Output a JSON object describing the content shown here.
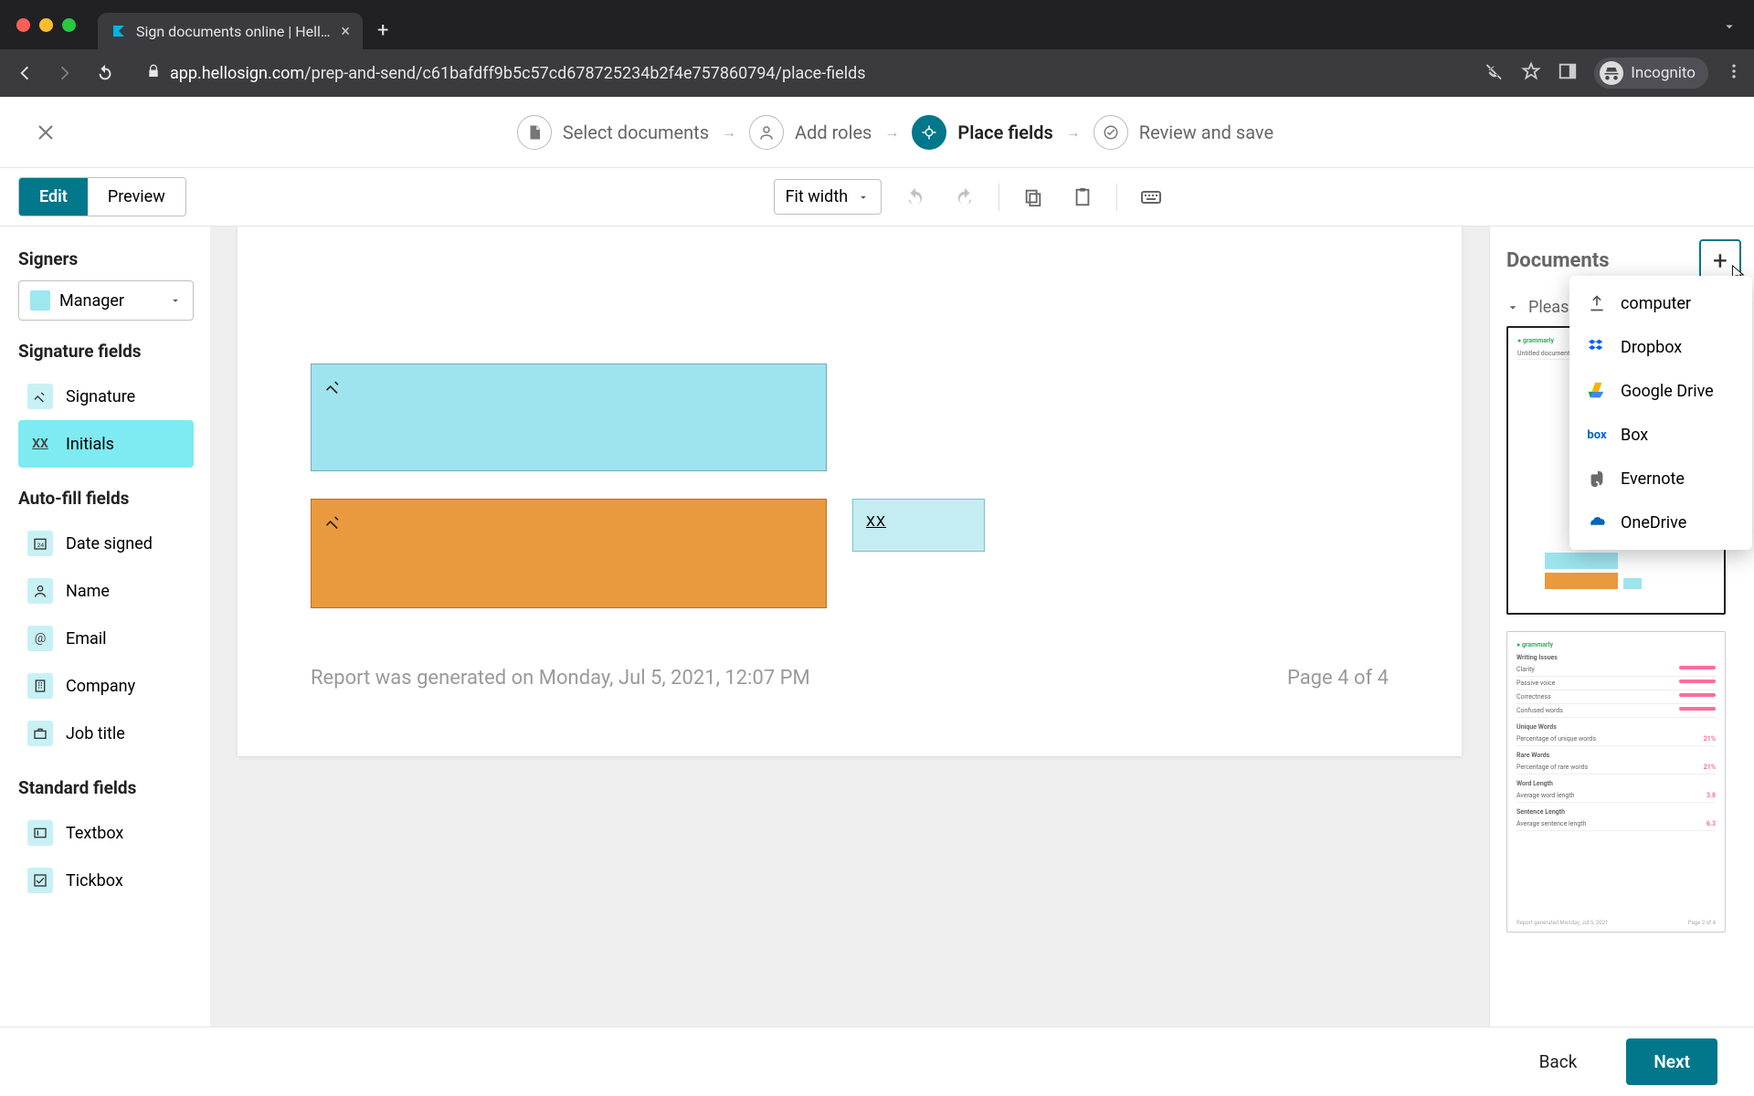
{
  "browser": {
    "tab_title": "Sign documents online | HelloS",
    "url_host": "app.hellosign.com",
    "url_path": "/prep-and-send/c61bafdff9b5c57cd678725234b2f4e757860794/place-fields",
    "incognito_label": "Incognito"
  },
  "stepper": {
    "steps": [
      "Select documents",
      "Add roles",
      "Place fields",
      "Review and save"
    ],
    "active_index": 2
  },
  "toolbar": {
    "edit_label": "Edit",
    "preview_label": "Preview",
    "zoom_label": "Fit width"
  },
  "left_panel": {
    "signers_heading": "Signers",
    "signer_selected": "Manager",
    "sig_heading": "Signature fields",
    "sig_fields": [
      "Signature",
      "Initials"
    ],
    "sig_selected_index": 1,
    "auto_heading": "Auto-fill fields",
    "auto_fields": [
      "Date signed",
      "Name",
      "Email",
      "Company",
      "Job title"
    ],
    "std_heading": "Standard fields",
    "std_fields": [
      "Textbox",
      "Tickbox"
    ]
  },
  "canvas": {
    "initials_tag": "XX",
    "report_line": "Report was generated on Monday, Jul 5, 2021, 12:07 PM",
    "page_label": "Page 4 of 4"
  },
  "right_panel": {
    "title": "Documents",
    "doc_name_preview": "Pleas",
    "upload_menu": [
      "computer",
      "Dropbox",
      "Google Drive",
      "Box",
      "Evernote",
      "OneDrive"
    ]
  },
  "thumb2": {
    "sections": [
      {
        "h": "Writing Issues",
        "rows": [
          [
            "Clarity",
            ""
          ],
          [
            "Passive voice",
            ""
          ],
          [
            "Correctness",
            ""
          ],
          [
            "Confused words",
            ""
          ]
        ]
      },
      {
        "h": "Unique Words",
        "rows": [
          [
            "Percentage of unique words",
            "21%"
          ]
        ]
      },
      {
        "h": "Rare Words",
        "rows": [
          [
            "Percentage of rare words",
            "21%"
          ]
        ]
      },
      {
        "h": "Word Length",
        "rows": [
          [
            "Average word length",
            "3.8"
          ]
        ]
      },
      {
        "h": "Sentence Length",
        "rows": [
          [
            "Average sentence length",
            "6.3"
          ]
        ]
      }
    ]
  },
  "footer": {
    "back_label": "Back",
    "next_label": "Next"
  }
}
